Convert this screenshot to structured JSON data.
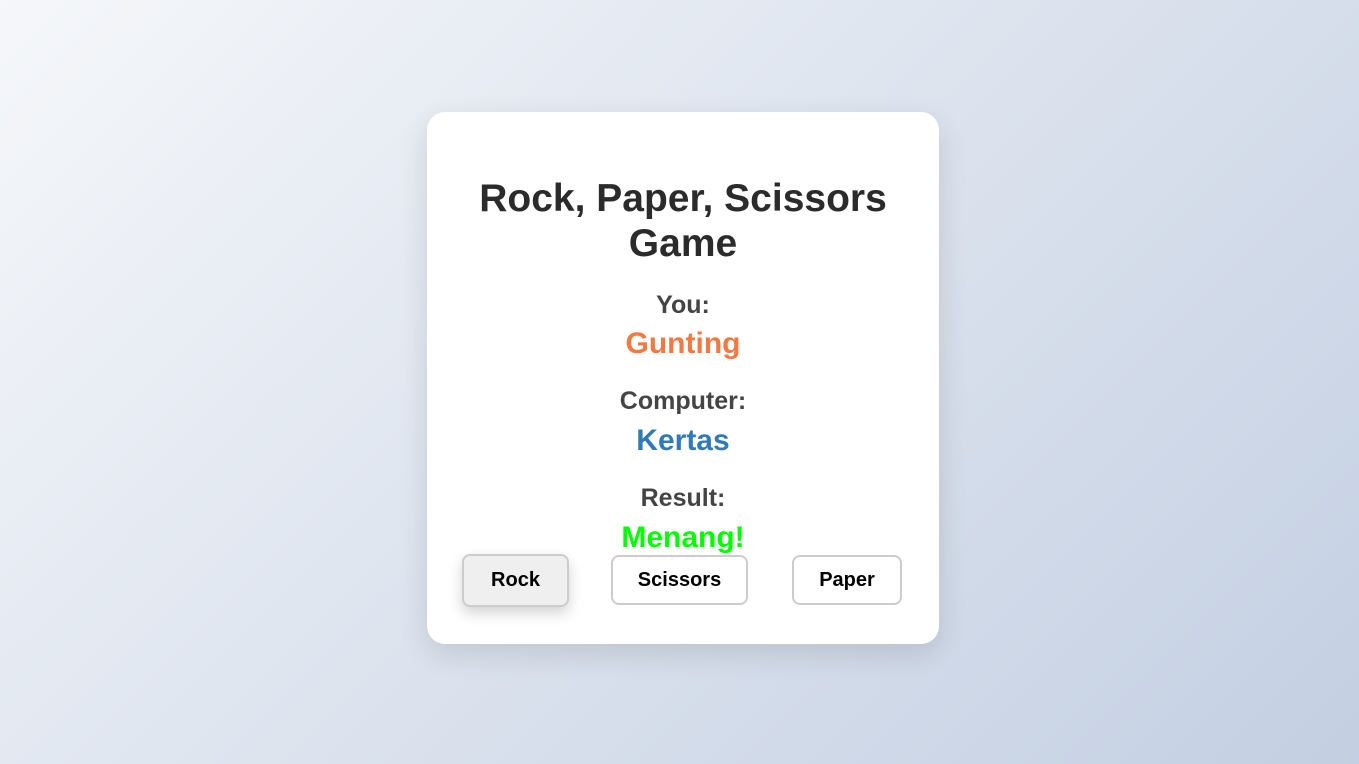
{
  "game": {
    "title": "Rock, Paper, Scissors Game",
    "you_label": "You:",
    "you_value": "Gunting",
    "computer_label": "Computer:",
    "computer_value": "Kertas",
    "result_label": "Result:",
    "result_value": "Menang!"
  },
  "buttons": {
    "rock": "Rock",
    "scissors": "Scissors",
    "paper": "Paper"
  },
  "colors": {
    "you_choice": "#f27a42",
    "computer_choice": "#2f7ab7",
    "result_win": "#00ff00"
  }
}
